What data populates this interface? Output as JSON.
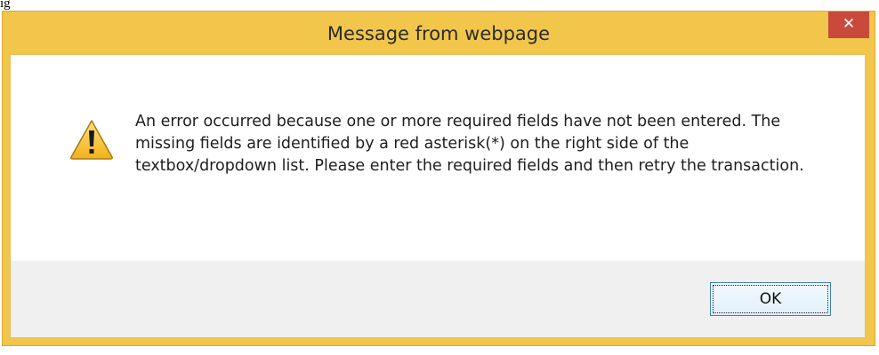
{
  "caption_fragment": "ig",
  "dialog": {
    "title": "Message from webpage",
    "close_glyph": "✕",
    "icon": "warning-triangle-icon",
    "message": "An error occurred because one or more required fields have not been entered. The missing fields are identified by a red asterisk(*) on the right side of the textbox/dropdown list. Please enter the required fields and then retry the transaction.",
    "ok_label": "OK"
  },
  "colors": {
    "frame": "#f2c64b",
    "close_button": "#c94a3c",
    "footer": "#f0f0f0",
    "ok_border": "#3c7fb1"
  }
}
